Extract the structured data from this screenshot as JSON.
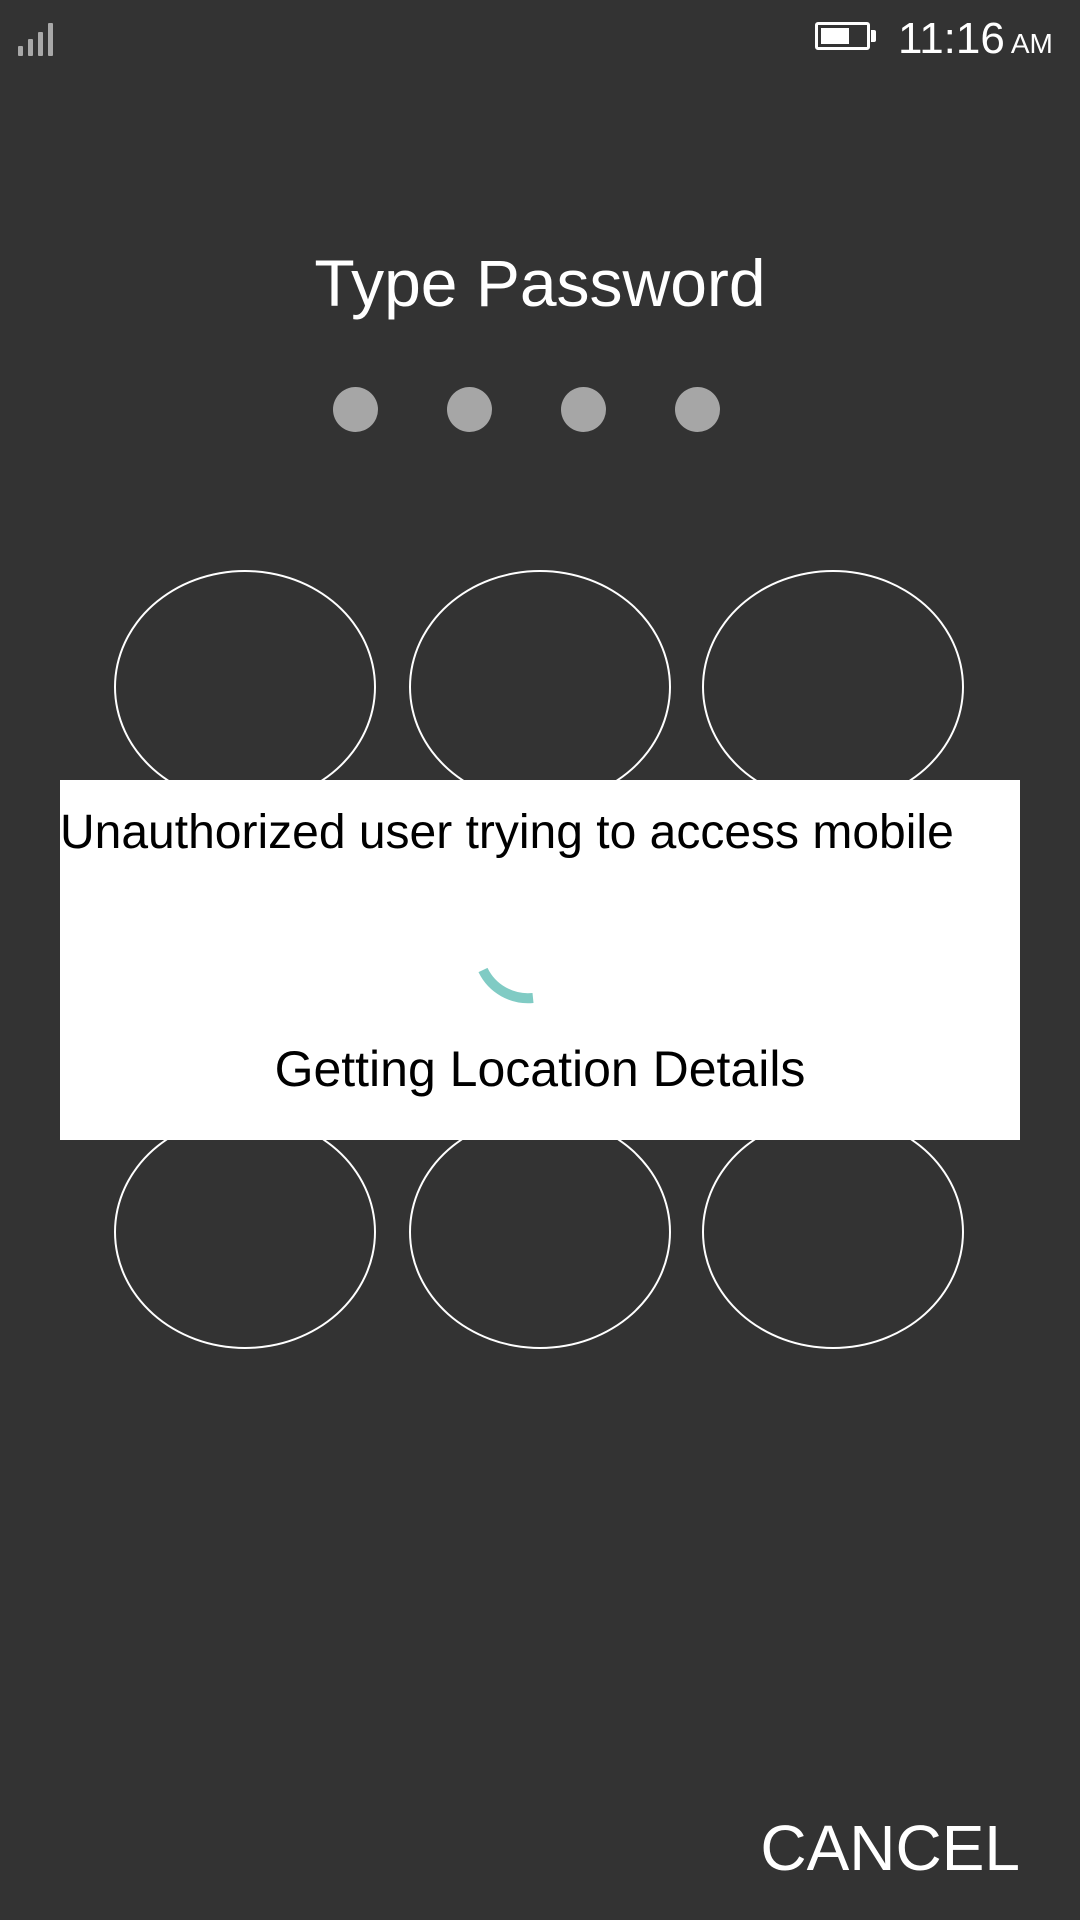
{
  "status_bar": {
    "time": "11:16",
    "ampm": "AM",
    "signal_icon": "signal-icon",
    "battery_icon": "battery-icon",
    "battery_level": 0.65
  },
  "lock_screen": {
    "title": "Type Password",
    "pin_dots_count": 4,
    "dot_color": "#a6a6a6",
    "background_color": "#333333"
  },
  "dialog": {
    "message": "Unauthorized user trying to access mobile",
    "status": "Getting Location Details",
    "spinner_color": "#80cbc4"
  },
  "actions": {
    "cancel_label": "CANCEL"
  }
}
